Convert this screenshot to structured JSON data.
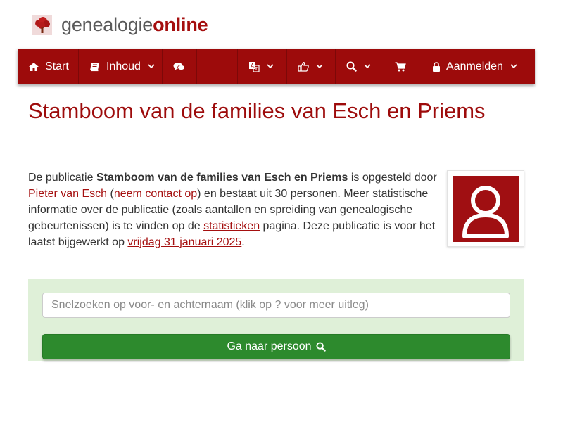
{
  "logo": {
    "part1": "genealogie",
    "part2": "online",
    "icon": "tree-icon"
  },
  "nav": {
    "start": {
      "label": "Start",
      "icon": "home-icon"
    },
    "inhoud": {
      "label": "Inhoud",
      "icon": "book-icon"
    },
    "comments": {
      "icon": "comments-icon"
    },
    "language": {
      "icon": "translate-icon"
    },
    "thumbs": {
      "icon": "thumbs-up-icon"
    },
    "search": {
      "icon": "search-icon"
    },
    "cart": {
      "icon": "cart-icon"
    },
    "login": {
      "label": "Aanmelden",
      "icon": "lock-icon"
    }
  },
  "page": {
    "title": "Stamboom van de families van Esch en Priems"
  },
  "description": {
    "t1": "De publicatie ",
    "pub_title": "Stamboom van de families van Esch en Priems",
    "t2": " is opgesteld door ",
    "author": "Pieter van Esch",
    "t3": " (",
    "contact": "neem contact op",
    "t4": ") en bestaat uit 30 personen. Meer statistische informatie over de publicatie (zoals aantallen en spreiding van genealogische gebeurtenissen) is te vinden op de ",
    "stats": "statistieken",
    "t5": " pagina. Deze publicatie is voor het laatst bijgewerkt op ",
    "date": "vrijdag 31 januari 2025",
    "t6": "."
  },
  "search": {
    "placeholder": "Snelzoeken op voor- en achternaam (klik op ? voor meer uitleg)",
    "value": "",
    "button_label": "Ga naar persoon"
  },
  "colors": {
    "brand": "#9d0b0b",
    "panel": "#dff0d8",
    "button": "#2d8a2d"
  }
}
